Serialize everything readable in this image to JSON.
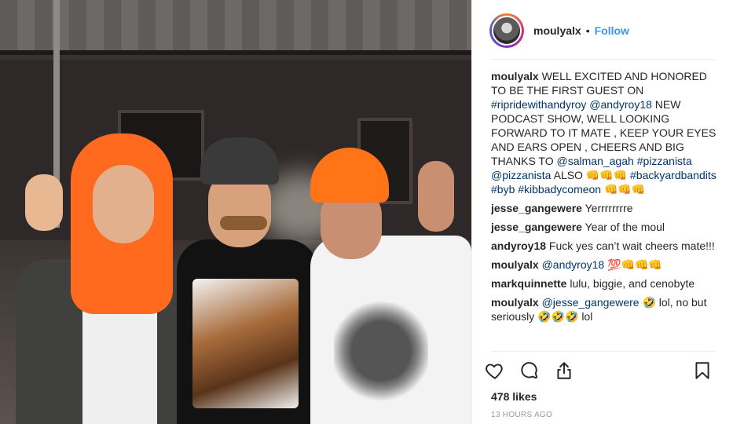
{
  "header": {
    "username": "moulyalx",
    "separator": "•",
    "follow_label": "Follow"
  },
  "comments": [
    {
      "user": "moulyalx",
      "parts": [
        {
          "t": " WELL EXCITED AND HONORED TO BE THE FIRST GUEST ON "
        },
        {
          "t": "#ripridewithandyroy",
          "link": true
        },
        {
          "t": " "
        },
        {
          "t": "@andyroy18",
          "link": true
        },
        {
          "t": " NEW PODCAST SHOW, WELL LOOKING FORWARD TO IT MATE , KEEP YOUR EYES AND EARS OPEN , CHEERS AND BIG THANKS TO "
        },
        {
          "t": "@salman_agah",
          "link": true
        },
        {
          "t": " "
        },
        {
          "t": "#pizzanista",
          "link": true
        },
        {
          "t": " "
        },
        {
          "t": "@pizzanista",
          "link": true
        },
        {
          "t": " ALSO 👊👊👊 "
        },
        {
          "t": "#backyardbandits",
          "link": true
        },
        {
          "t": " "
        },
        {
          "t": "#byb",
          "link": true
        },
        {
          "t": " "
        },
        {
          "t": "#kibbadycomeon",
          "link": true
        },
        {
          "t": " 👊👊👊"
        }
      ]
    },
    {
      "user": "jesse_gangewere",
      "parts": [
        {
          "t": " Yerrrrrrrre"
        }
      ]
    },
    {
      "user": "jesse_gangewere",
      "parts": [
        {
          "t": " Year of the moul"
        }
      ]
    },
    {
      "user": "andyroy18",
      "parts": [
        {
          "t": " Fuck yes can’t wait cheers mate!!!"
        }
      ]
    },
    {
      "user": "moulyalx",
      "parts": [
        {
          "t": " "
        },
        {
          "t": "@andyroy18",
          "link": true
        },
        {
          "t": " 💯👊👊👊"
        }
      ]
    },
    {
      "user": "markquinnette",
      "parts": [
        {
          "t": " lulu, biggie, and cenobyte"
        }
      ]
    },
    {
      "user": "moulyalx",
      "parts": [
        {
          "t": " "
        },
        {
          "t": "@jesse_gangewere",
          "link": true
        },
        {
          "t": " 🤣 lol, no but seriously 🤣🤣🤣 lol"
        }
      ]
    }
  ],
  "actions": {
    "icons": [
      "heart-icon",
      "comment-icon",
      "share-icon",
      "bookmark-icon"
    ]
  },
  "likes_label": "478 likes",
  "timestamp": "13 HOURS AGO",
  "colors": {
    "follow": "#3897f0",
    "link": "#003569",
    "text": "#262626",
    "muted": "#999999"
  }
}
